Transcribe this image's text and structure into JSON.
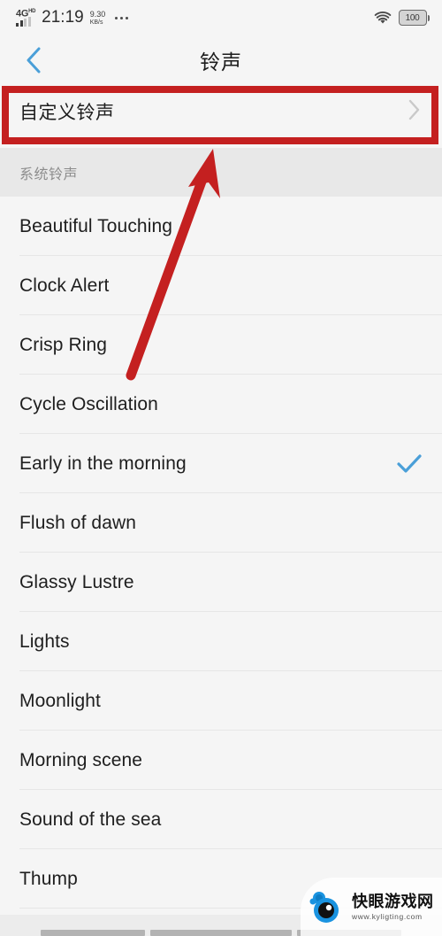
{
  "status_bar": {
    "network_type": "4G",
    "network_type_sup": "HD",
    "time": "21:19",
    "net_speed_value": "9.30",
    "net_speed_unit": "KB/s",
    "overflow_icon": "more-dots-icon",
    "wifi_icon": "wifi-icon",
    "battery_level": "100"
  },
  "header": {
    "back_icon": "chevron-left-icon",
    "title": "铃声"
  },
  "custom_row": {
    "label": "自定义铃声",
    "chevron_icon": "chevron-right-icon"
  },
  "section": {
    "title": "系统铃声"
  },
  "ringtones": [
    {
      "name": "Beautiful Touching",
      "selected": false
    },
    {
      "name": "Clock Alert",
      "selected": false
    },
    {
      "name": "Crisp Ring",
      "selected": false
    },
    {
      "name": "Cycle Oscillation",
      "selected": false
    },
    {
      "name": "Early in the morning",
      "selected": true
    },
    {
      "name": "Flush of dawn",
      "selected": false
    },
    {
      "name": "Glassy Lustre",
      "selected": false
    },
    {
      "name": "Lights",
      "selected": false
    },
    {
      "name": "Moonlight",
      "selected": false
    },
    {
      "name": "Morning scene",
      "selected": false
    },
    {
      "name": "Sound of the sea",
      "selected": false
    },
    {
      "name": "Thump",
      "selected": false
    }
  ],
  "annotations": {
    "box_color": "#c42020",
    "arrow_color": "#c42020",
    "arrow_icon": "red-arrow-annotation",
    "box_icon": "red-highlight-box"
  },
  "watermark": {
    "logo_icon": "eyeball-logo-icon",
    "title": "快眼游戏网",
    "url": "www.kyligting.com"
  },
  "navbar": {
    "recents_icon": "nav-recents-bar",
    "home_icon": "nav-home-bar",
    "back_icon": "nav-back-bar"
  },
  "colors": {
    "accent_blue": "#4a9fd8",
    "annotation_red": "#c42020",
    "page_bg": "#f5f5f5",
    "section_bg": "#e8e8e8"
  }
}
